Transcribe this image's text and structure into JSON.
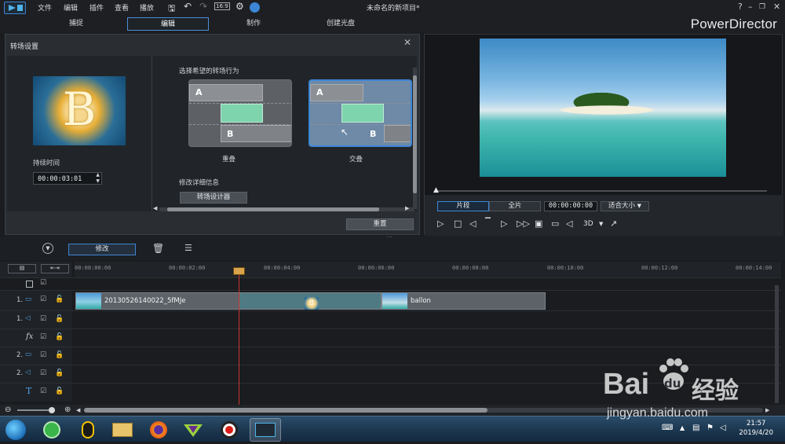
{
  "titlebar": {
    "menus": [
      "文件",
      "编辑",
      "插件",
      "查看",
      "播放"
    ],
    "project_title": "未命名的新项目*",
    "help": "?"
  },
  "modes": [
    "捕捉",
    "编辑",
    "制作",
    "创建光盘"
  ],
  "brand": "PowerDirector",
  "transition_panel": {
    "title": "转场设置",
    "duration_label": "持续时间",
    "duration_value": "00:00:03:01",
    "behavior_label": "选择希望的转场行为",
    "options": [
      {
        "name": "重叠",
        "a": "A",
        "b": "B",
        "selected": false
      },
      {
        "name": "交叠",
        "a": "A",
        "b": "B",
        "selected": true
      }
    ],
    "modify_label": "修改详细信息",
    "designer_button": "转场设计器",
    "reset_button": "重置",
    "thumb_letter": "B"
  },
  "viewer": {
    "tab_clip": "片段",
    "tab_movie": "全片",
    "timecode": "00:00:00:00",
    "fit": "适合大小",
    "threed": "3D"
  },
  "toolbar": {
    "modify_button": "修改"
  },
  "timeline": {
    "ticks": [
      "00:00:00:00",
      "00:00:02:00",
      "00:00:04:00",
      "00:00:06:00",
      "00:00:08:00",
      "00:00:10:00",
      "00:00:12:00",
      "00:00:14:00"
    ],
    "tracks": [
      {
        "num": "1.",
        "type": "video"
      },
      {
        "num": "1.",
        "type": "audio"
      },
      {
        "num": "",
        "type": "fx",
        "symbol": "fx"
      },
      {
        "num": "2.",
        "type": "video"
      },
      {
        "num": "2.",
        "type": "audio"
      },
      {
        "num": "",
        "type": "title",
        "symbol": "T"
      }
    ],
    "clips": [
      {
        "label": "20130526140022_5fMJe"
      },
      {
        "label": "ballon"
      }
    ]
  },
  "taskbar": {
    "time": "21:57",
    "date": "2019/4/20"
  },
  "watermark": {
    "brand": "Bai",
    "paw": "du",
    "cn": "经验",
    "url": "jingyan.baidu.com"
  }
}
